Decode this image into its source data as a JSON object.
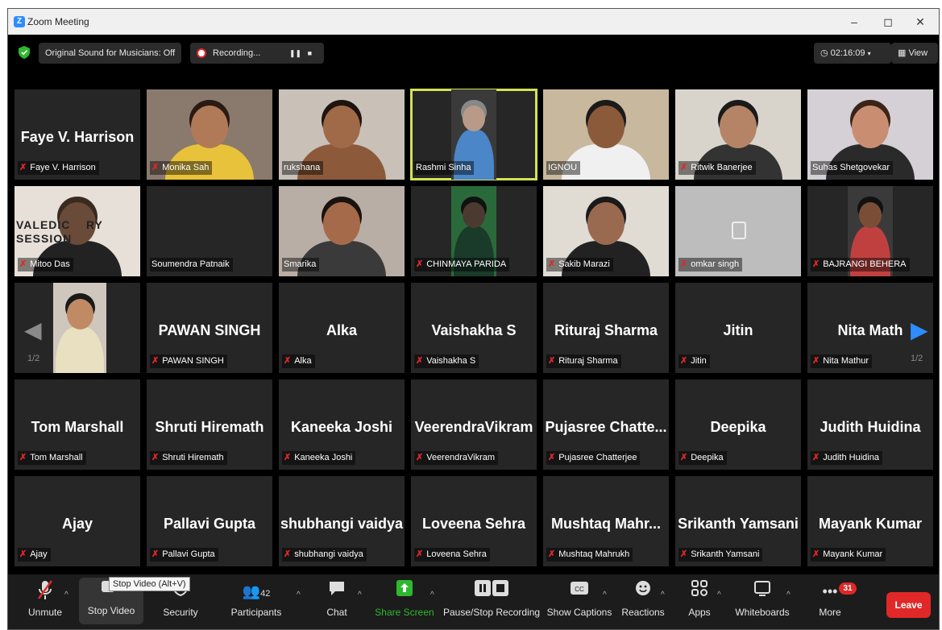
{
  "window": {
    "title": "Zoom Meeting",
    "minimize": "–",
    "maximize": "◻",
    "close": "✕"
  },
  "topbar": {
    "sound_label": "Original Sound for Musicians: Off",
    "recording_label": "Recording...",
    "pause_symbol": "❚❚",
    "stop_symbol": "■",
    "timer": "02:16:09",
    "view_label": "View"
  },
  "tiles": [
    {
      "name": "Faye V. Harrison",
      "big": "Faye V. Harrison",
      "muted": true
    },
    {
      "name": "Monika Sah",
      "video": true,
      "muted": true
    },
    {
      "name": "rukshana",
      "video": true,
      "muted": false
    },
    {
      "name": "Rashmi Sinha",
      "video": true,
      "muted": false,
      "active": true
    },
    {
      "name": "IGNOU",
      "video": true,
      "muted": false
    },
    {
      "name": "Ritwik Banerjee",
      "video": true,
      "muted": true
    },
    {
      "name": "Suhas Shetgovekar",
      "video": true,
      "muted": false
    },
    {
      "name": "Mitoo Das",
      "video": true,
      "muted": true
    },
    {
      "name": "Soumendra Patnaik",
      "video": false,
      "muted": false
    },
    {
      "name": "Smarika",
      "video": true,
      "muted": false
    },
    {
      "name": "CHINMAYA PARIDA",
      "video": true,
      "muted": true
    },
    {
      "name": "Sakib Marazi",
      "video": true,
      "muted": true
    },
    {
      "name": "omkar singh",
      "video": true,
      "muted": true
    },
    {
      "name": "BAJRANGI BEHERA",
      "video": true,
      "muted": true
    },
    {
      "name": "",
      "video": true,
      "muted": false
    },
    {
      "name": "PAWAN SINGH",
      "big": "PAWAN SINGH",
      "muted": true
    },
    {
      "name": "Alka",
      "big": "Alka",
      "muted": true
    },
    {
      "name": "Vaishakha S",
      "big": "Vaishakha S",
      "muted": true
    },
    {
      "name": "Rituraj Sharma",
      "big": "Rituraj Sharma",
      "muted": true
    },
    {
      "name": "Jitin",
      "big": "Jitin",
      "muted": true
    },
    {
      "name": "Nita Mathur",
      "big": "Nita Math",
      "muted": true
    },
    {
      "name": "Tom Marshall",
      "big": "Tom Marshall",
      "muted": true
    },
    {
      "name": "Shruti Hiremath",
      "big": "Shruti Hiremath",
      "muted": true
    },
    {
      "name": "Kaneeka Joshi",
      "big": "Kaneeka Joshi",
      "muted": true
    },
    {
      "name": "VeerendraVikram",
      "big": "VeerendraVikram",
      "muted": true
    },
    {
      "name": "Pujasree Chatterjee",
      "big": "Pujasree  Chatte...",
      "muted": true
    },
    {
      "name": "Deepika",
      "big": "Deepika",
      "muted": true
    },
    {
      "name": "Judith Huidina",
      "big": "Judith Huidina",
      "muted": true
    },
    {
      "name": "Ajay",
      "big": "Ajay",
      "muted": true
    },
    {
      "name": "Pallavi Gupta",
      "big": "Pallavi Gupta",
      "muted": true
    },
    {
      "name": "shubhangi vaidya",
      "big": "shubhangi vaidya",
      "muted": true
    },
    {
      "name": "Loveena Sehra",
      "big": "Loveena Sehra",
      "muted": true
    },
    {
      "name": "Mushtaq Mahrukh",
      "big": "Mushtaq  Mahr...",
      "muted": true
    },
    {
      "name": "Srikanth Yamsani",
      "big": "Srikanth Yamsani",
      "muted": true
    },
    {
      "name": "Mayank Kumar",
      "big": "Mayank Kumar",
      "muted": true
    }
  ],
  "pager": {
    "left": "1/2",
    "right": "1/2"
  },
  "valedictory_text": "VALEDIC    RY\nSESSION",
  "toolbar": {
    "unmute": "Unmute",
    "stop_video": "Stop Video",
    "security": "Security",
    "participants": "Participants",
    "participants_count": "42",
    "chat": "Chat",
    "share_screen": "Share Screen",
    "pause_stop_recording": "Pause/Stop Recording",
    "show_captions": "Show Captions",
    "reactions": "Reactions",
    "apps": "Apps",
    "whiteboards": "Whiteboards",
    "more": "More",
    "more_badge": "31",
    "leave": "Leave",
    "tooltip": "Stop Video (Alt+V)"
  },
  "colors": {
    "accent": "#2d8cff",
    "muted_red": "#e02828",
    "share_green": "#2eb82e",
    "active_border": "#d4e157"
  }
}
